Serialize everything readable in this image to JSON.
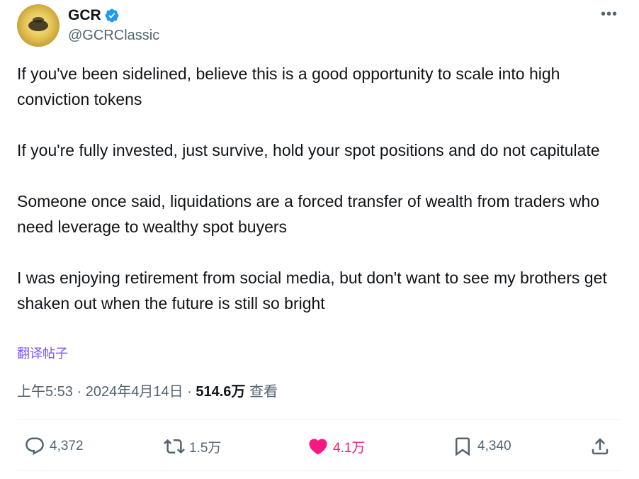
{
  "author": {
    "display_name": "GCR",
    "handle": "@GCRClassic",
    "verified": true,
    "avatar_icon": "gold-coin-avatar"
  },
  "menu": {
    "more_icon": "more-dots-icon",
    "more_label": "•••"
  },
  "tweet": {
    "paragraphs": [
      "If you've been sidelined, believe this is a good opportunity to scale into high conviction tokens",
      "If you're fully invested, just survive, hold your spot positions and do not capitulate",
      "Someone once said, liquidations are a forced transfer of wealth from traders who need leverage to wealthy spot buyers",
      "I was enjoying retirement from social media, but don't want to see my brothers get shaken out when the future is still so bright"
    ],
    "translate_label": "翻译帖子"
  },
  "meta": {
    "time": "上午5:53",
    "separator": " · ",
    "date": "2024年4月14日",
    "views_count": "514.6万",
    "views_label": " 查看"
  },
  "actions": {
    "reply": {
      "count": "4,372",
      "icon": "reply-icon"
    },
    "retweet": {
      "count": "1.5万",
      "icon": "retweet-icon"
    },
    "like": {
      "count": "4.1万",
      "icon": "heart-icon",
      "liked": true
    },
    "bookmark": {
      "count": "4,340",
      "icon": "bookmark-icon"
    },
    "share": {
      "icon": "share-icon"
    }
  },
  "colors": {
    "text": "#0f1419",
    "secondary": "#536471",
    "like": "#f91880",
    "verified": "#1d9bf0",
    "translate": "#7856ff"
  }
}
